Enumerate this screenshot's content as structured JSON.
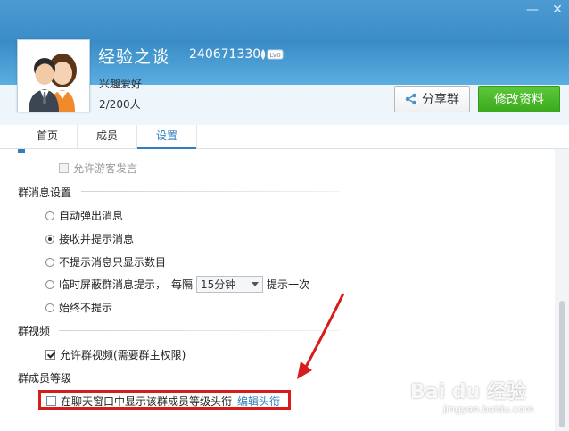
{
  "header": {
    "group_name": "经验之谈",
    "group_id": "240671330",
    "level_badge": "LV0",
    "interest": "兴趣爱好",
    "member_count": "2/200人",
    "share_label": "分享群",
    "edit_label": "修改资料"
  },
  "tabs": [
    {
      "label": "首页"
    },
    {
      "label": "成员"
    },
    {
      "label": "设置"
    }
  ],
  "settings": {
    "guest_speak": "允许游客发言",
    "message_section": "群消息设置",
    "options": [
      {
        "label": "自动弹出消息",
        "selected": false
      },
      {
        "label": "接收并提示消息",
        "selected": true
      },
      {
        "label": "不提示消息只显示数目",
        "selected": false
      },
      {
        "label": "临时屏蔽群消息提示，",
        "selected": false
      },
      {
        "label": "始终不提示",
        "selected": false
      }
    ],
    "interval_prefix": "每隔",
    "interval_value": "15分钟",
    "interval_suffix": "提示一次",
    "video_section": "群视频",
    "video_allow": "允许群视频(需要群主权限)",
    "level_section": "群成员等级",
    "level_show": "在聊天窗口中显示该群成员等级头衔",
    "level_edit_link": "编辑头衔"
  },
  "watermark": {
    "brand": "Bai du 经验",
    "url": "jingyan.baidu.com"
  },
  "colors": {
    "header_blue": "#3d8fc8",
    "accent_blue": "#2f7fc1",
    "edit_green": "#3aaa1c",
    "highlight_red": "#d81c1c"
  }
}
